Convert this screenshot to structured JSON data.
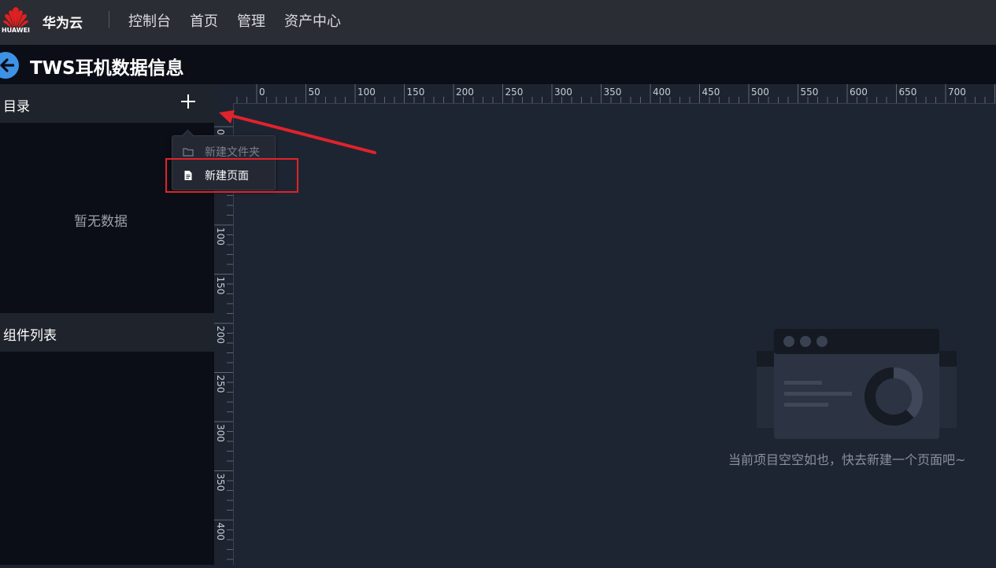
{
  "header": {
    "logo_text": "HUAWEI",
    "brand": "华为云",
    "nav": [
      "控制台",
      "首页",
      "管理",
      "资产中心"
    ]
  },
  "titlebar": {
    "title": "TWS耳机数据信息"
  },
  "sidebar": {
    "directory_label": "目录",
    "empty_text": "暂无数据",
    "components_label": "组件列表"
  },
  "dropdown": {
    "items": [
      {
        "label": "新建文件夹",
        "icon": "folder-icon",
        "state": "disabled"
      },
      {
        "label": "新建页面",
        "icon": "document-icon",
        "state": "highlighted"
      }
    ]
  },
  "ruler": {
    "top_labels": [
      "0",
      "50",
      "100",
      "150",
      "200",
      "250",
      "300",
      "350",
      "400",
      "450",
      "500",
      "550",
      "600",
      "650",
      "700"
    ],
    "left_labels": [
      "0",
      "100",
      "150",
      "200",
      "250",
      "300",
      "350",
      "400"
    ]
  },
  "canvas": {
    "empty_text": "当前项目空空如也，快去新建一个页面吧~"
  },
  "colors": {
    "accent": "#3d92e6",
    "highlight": "#e0232c",
    "brand_red": "#e02020"
  }
}
